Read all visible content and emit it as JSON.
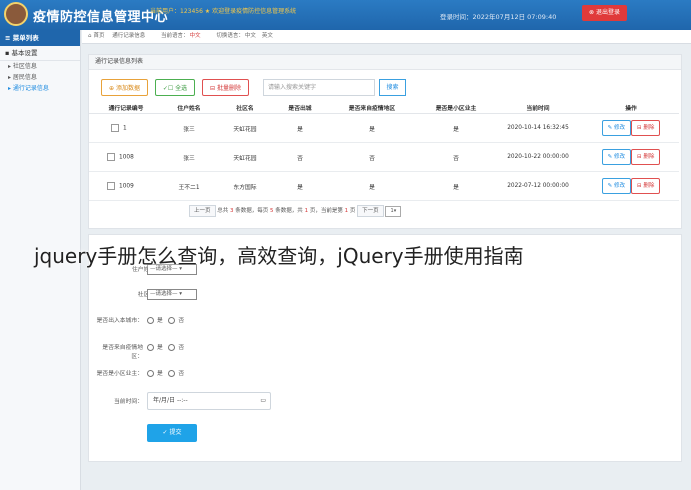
{
  "header": {
    "title": "疫情防控信息管理中心",
    "note": "当前用户：123456 ★ 欢迎登录疫情防控信息管理系统",
    "time": "登录时间：2022年07月12日 07:09:40",
    "logout": "⊗ 退出登录"
  },
  "sidebar": {
    "title": "菜单列表",
    "group": "基本设置",
    "items": [
      "社区信息",
      "居民信息",
      "通行记录信息"
    ]
  },
  "breadcrumb": {
    "home": "首页",
    "current": "通行记录信息",
    "lang1_label": "当前语言：",
    "lang1_value": "中文",
    "lang2_label": "切换语言：",
    "lang2_a": "中文",
    "lang2_b": "英文"
  },
  "panel": {
    "title": "通行记录信息列表",
    "toolbar": {
      "add": "添加数据",
      "select_all": "全选",
      "batch_delete": "批量删除",
      "search_placeholder": "请输入搜索关键字",
      "search": "搜索"
    },
    "columns": [
      "通行记录编号",
      "住户姓名",
      "社区名",
      "是否出城",
      "是否来自疫情地区",
      "是否是小区业主",
      "当前时间",
      "操作"
    ],
    "rows": [
      [
        "1",
        "张三",
        "天虹花园",
        "是",
        "是",
        "是",
        "2020-10-14 16:32:45"
      ],
      [
        "1008",
        "张三",
        "天虹花园",
        "否",
        "否",
        "否",
        "2020-10-22 00:00:00"
      ],
      [
        "1009",
        "王不二1",
        "东方国际",
        "是",
        "是",
        "是",
        "2022-07-12 00:00:00"
      ]
    ],
    "edit": "修改",
    "delete": "删除",
    "pager": {
      "prev": "上一页",
      "total_prefix": "总共",
      "total": "3",
      "total_suffix": "条数据，每页",
      "per_page": "5",
      "per_suffix": "条数据，共",
      "pages": "1",
      "pages_suffix": "页，当前是第",
      "current": "1",
      "current_suffix": "页",
      "next": "下一页",
      "select": "1"
    }
  },
  "form": {
    "resident_label": "住户姓名：",
    "resident_select": "—请选择—",
    "community_label": "社区名：",
    "community_select": "—请选择—",
    "out_label": "是否出入本城市：",
    "area_label": "是否来自疫情地区：",
    "owner_label": "是否是小区业主：",
    "yes": "是",
    "no": "否",
    "time_label": "当前时间：",
    "date_value": "年/月/日  --:-- ",
    "submit": "提交"
  },
  "overlay_text": "jquery手册怎么查询，高效查询，jQuery手册使用指南",
  "colors": {
    "header": "#1f66ac",
    "accent": "#1f8ce0",
    "danger": "#d43a3a"
  }
}
